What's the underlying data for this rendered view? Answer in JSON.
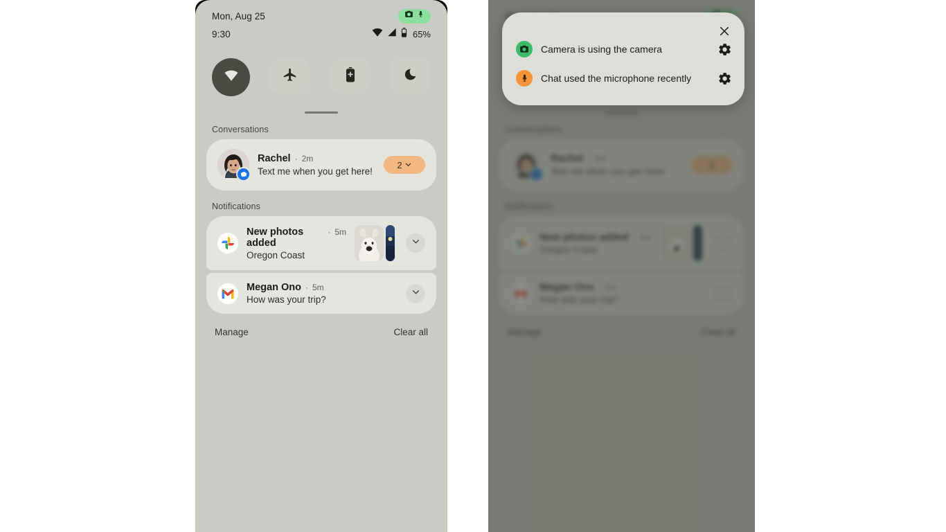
{
  "status_bar": {
    "date": "Mon, Aug 25",
    "time": "9:30",
    "battery_percent": "65%",
    "privacy_indicator": {
      "camera_icon": "camera-icon",
      "mic_icon": "microphone-icon",
      "color": "#8ddf9e"
    },
    "icons": [
      "wifi-icon",
      "cellular-signal-icon",
      "battery-icon"
    ]
  },
  "quick_settings": {
    "tiles": [
      {
        "name": "wifi",
        "icon": "wifi-icon",
        "active": true
      },
      {
        "name": "airplane-mode",
        "icon": "airplane-icon",
        "active": false
      },
      {
        "name": "battery-saver",
        "icon": "battery-saver-icon",
        "active": false
      },
      {
        "name": "do-not-disturb",
        "icon": "moon-icon",
        "active": false
      }
    ]
  },
  "sections": {
    "conversations_label": "Conversations",
    "notifications_label": "Notifications"
  },
  "conversations": [
    {
      "sender": "Rachel",
      "separator": "·",
      "time": "2m",
      "message": "Text me when you get here!",
      "count": "2",
      "app_badge": "messages-icon",
      "avatar": "rachel-avatar"
    }
  ],
  "notifications": [
    {
      "app_icon": "google-photos-icon",
      "title": "New photos added",
      "separator": "·",
      "time": "5m",
      "body": "Oregon Coast",
      "has_thumbnails": true,
      "expand_icon": "chevron-down-icon"
    },
    {
      "app_icon": "gmail-icon",
      "title": "Megan Ono",
      "separator": "·",
      "time": "5m",
      "body": "How was your trip?",
      "has_thumbnails": false,
      "expand_icon": "chevron-down-icon"
    }
  ],
  "footer": {
    "manage": "Manage",
    "clear_all": "Clear all"
  },
  "privacy_dialog": {
    "close_icon": "close-icon",
    "items": [
      {
        "icon": "camera-icon",
        "icon_color": "#3dbb6b",
        "label": "Camera is using the camera",
        "settings_icon": "gear-icon"
      },
      {
        "icon": "microphone-icon",
        "icon_color": "#f59439",
        "label": "Chat used the microphone recently",
        "settings_icon": "gear-icon"
      }
    ]
  },
  "colors": {
    "panel_background": "#c9cbc4",
    "card_background": "#e4e5df",
    "accent_active_tile": "#494b41",
    "count_pill": "#f3b882",
    "dialog_background": "#dcdede"
  }
}
